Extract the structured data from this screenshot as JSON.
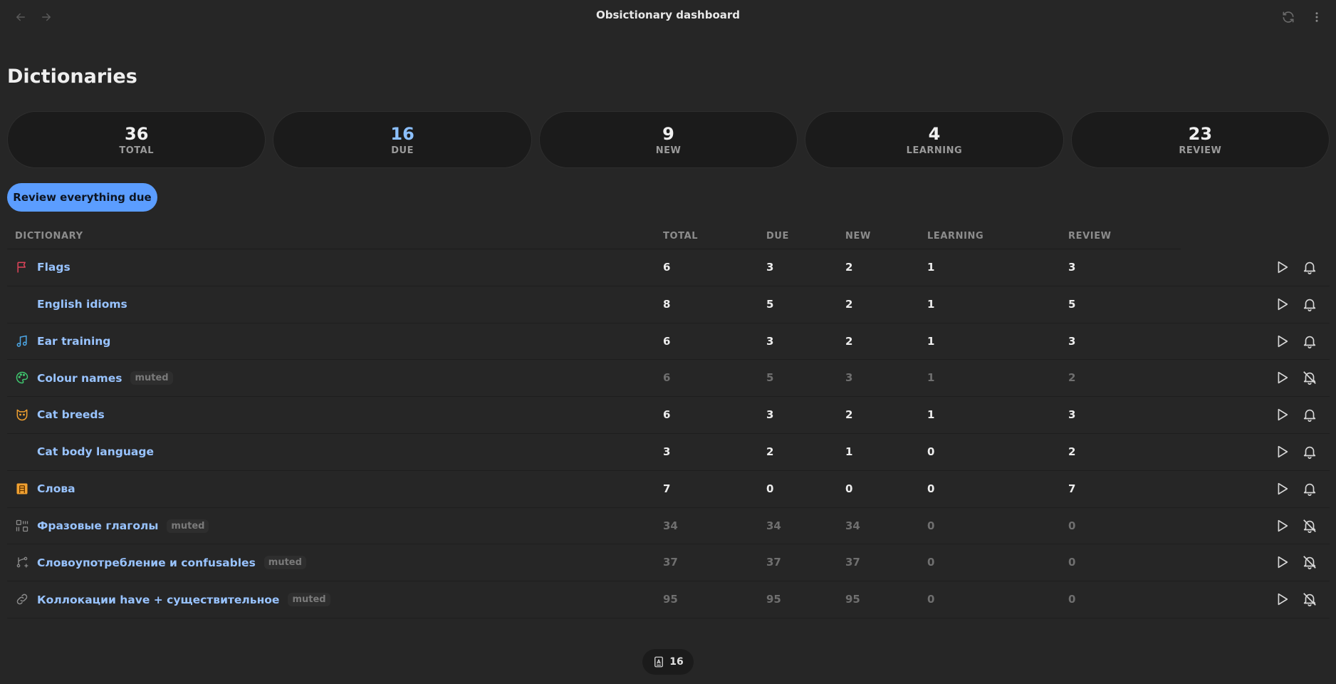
{
  "window": {
    "title": "Obsictionary dashboard"
  },
  "page": {
    "title": "Dictionaries"
  },
  "stats": [
    {
      "value": "36",
      "label": "Total",
      "accent": false
    },
    {
      "value": "16",
      "label": "Due",
      "accent": true
    },
    {
      "value": "9",
      "label": "New",
      "accent": false
    },
    {
      "value": "4",
      "label": "Learning",
      "accent": false
    },
    {
      "value": "23",
      "label": "Review",
      "accent": false
    }
  ],
  "review_button": {
    "label": "Review everything due"
  },
  "table": {
    "columns": {
      "dictionary": "Dictionary",
      "total": "Total",
      "due": "Due",
      "new": "New",
      "learning": "Learning",
      "review": "Review"
    },
    "muted_label": "muted",
    "rows": [
      {
        "icon": "flag-icon",
        "icon_color": "#e0445a",
        "name": "Flags",
        "total": "6",
        "due": "3",
        "new": "2",
        "learning": "1",
        "review": "3",
        "muted": false
      },
      {
        "icon": "",
        "icon_color": "",
        "name": "English idioms",
        "total": "8",
        "due": "5",
        "new": "2",
        "learning": "1",
        "review": "5",
        "muted": false
      },
      {
        "icon": "music-note-icon",
        "icon_color": "#4da8e8",
        "name": "Ear training",
        "total": "6",
        "due": "3",
        "new": "2",
        "learning": "1",
        "review": "3",
        "muted": false
      },
      {
        "icon": "palette-icon",
        "icon_color": "#3fc46e",
        "name": "Colour names",
        "total": "6",
        "due": "5",
        "new": "3",
        "learning": "1",
        "review": "2",
        "muted": true
      },
      {
        "icon": "cat-icon",
        "icon_color": "#f0a030",
        "name": "Cat breeds",
        "total": "6",
        "due": "3",
        "new": "2",
        "learning": "1",
        "review": "3",
        "muted": false
      },
      {
        "icon": "",
        "icon_color": "",
        "name": "Cat body language",
        "total": "3",
        "due": "2",
        "new": "1",
        "learning": "0",
        "review": "2",
        "muted": false
      },
      {
        "icon": "letter-block-icon",
        "icon_color": "#f0a030",
        "name": "Слова",
        "total": "7",
        "due": "0",
        "new": "0",
        "learning": "0",
        "review": "7",
        "muted": false
      },
      {
        "icon": "grid-icon",
        "icon_color": "#8a8a8a",
        "name": "Фразовые глаголы",
        "total": "34",
        "due": "34",
        "new": "34",
        "learning": "0",
        "review": "0",
        "muted": true
      },
      {
        "icon": "branch-icon",
        "icon_color": "#8a8a8a",
        "name": "Словоупотребление и confusables",
        "total": "37",
        "due": "37",
        "new": "37",
        "learning": "0",
        "review": "0",
        "muted": true
      },
      {
        "icon": "link-icon",
        "icon_color": "#8a8a8a",
        "name": "Коллокации have + существительное",
        "total": "95",
        "due": "95",
        "new": "95",
        "learning": "0",
        "review": "0",
        "muted": true
      }
    ]
  },
  "footer": {
    "count": "16"
  },
  "colors": {
    "background": "#262626",
    "card": "#1b1b1b",
    "accent": "#5b9dff",
    "link": "#98c3ff"
  }
}
